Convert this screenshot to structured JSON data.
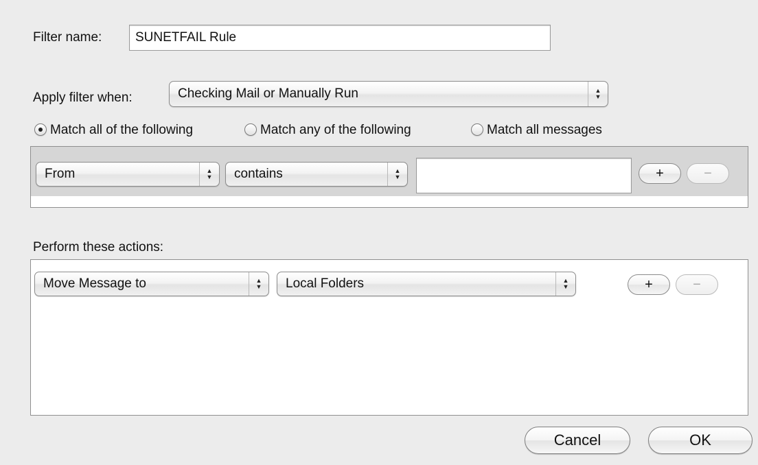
{
  "filter_name": {
    "label": "Filter name:",
    "value": "SUNETFAIL Rule"
  },
  "apply_filter": {
    "label": "Apply filter when:",
    "selected": "Checking Mail or Manually Run"
  },
  "match": {
    "options": [
      "Match all of the following",
      "Match any of the following",
      "Match all messages"
    ],
    "selected_index": 0
  },
  "rules": [
    {
      "field": "From",
      "operator": "contains",
      "value": ""
    }
  ],
  "actions_label": "Perform these actions:",
  "actions": [
    {
      "action": "Move Message to",
      "target": "Local Folders"
    }
  ],
  "buttons": {
    "plus": "+",
    "minus": "−",
    "cancel": "Cancel",
    "ok": "OK"
  },
  "icons": {
    "popup_arrows_up": "▲",
    "popup_arrows_down": "▼"
  }
}
